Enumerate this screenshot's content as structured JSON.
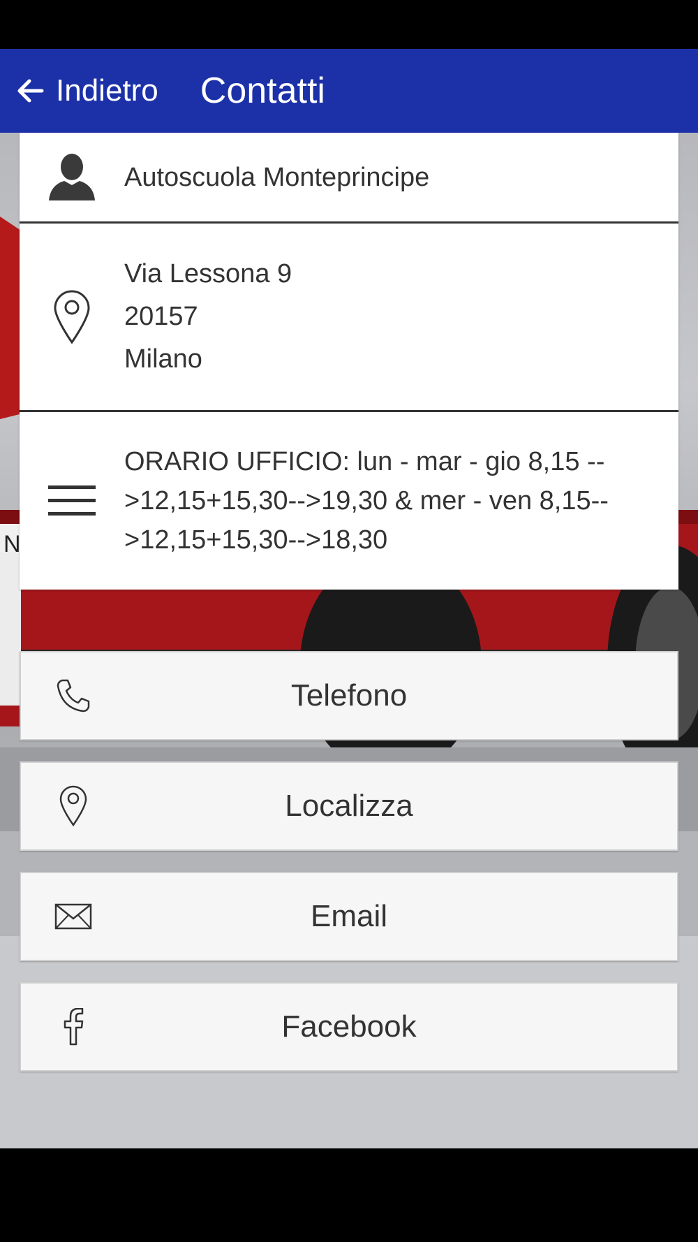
{
  "header": {
    "back_label": "Indietro",
    "title": "Contatti",
    "color": "#1c31a8"
  },
  "info": {
    "name": "Autoscuola Monteprincipe",
    "address": [
      "Via Lessona 9",
      "20157",
      "Milano"
    ],
    "hours": "ORARIO UFFICIO: lun - mar - gio 8,15 -->12,15+15,30-->19,30 & mer - ven 8,15-->12,15+15,30-->18,30"
  },
  "buttons": {
    "phone": "Telefono",
    "locate": "Localizza",
    "email": "Email",
    "facebook": "Facebook"
  },
  "icons": [
    "person-icon",
    "location-pin-icon",
    "menu-lines-icon",
    "phone-icon",
    "location-pin-icon",
    "envelope-icon",
    "facebook-icon",
    "back-arrow-icon"
  ]
}
